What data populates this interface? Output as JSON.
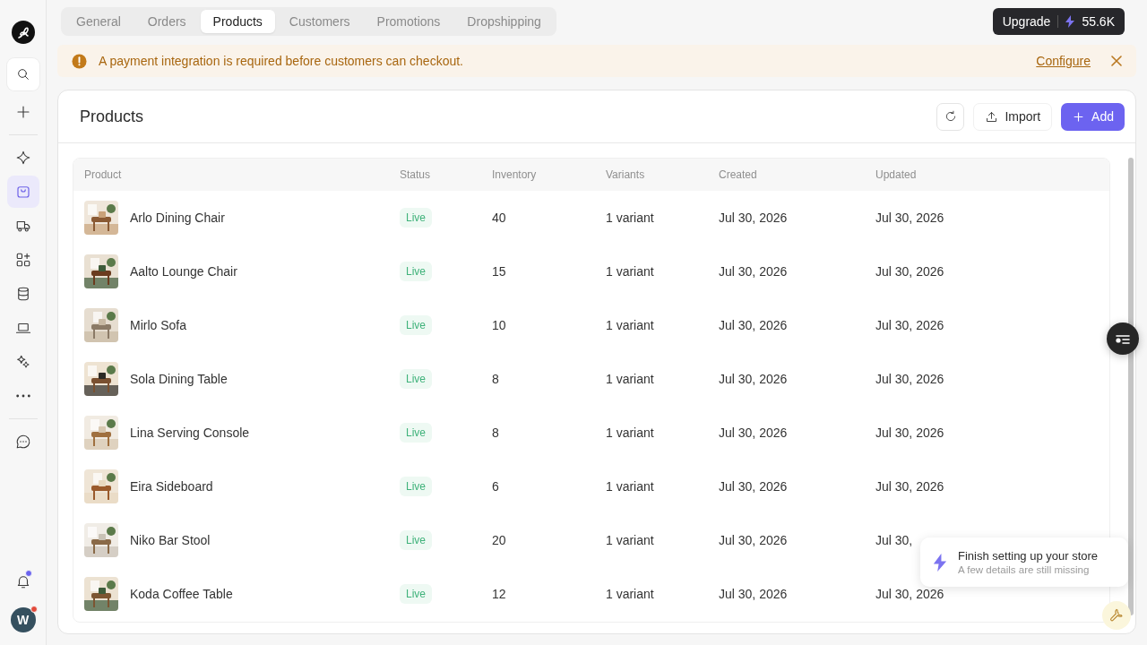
{
  "sidebar": {
    "avatar": "W",
    "items": [
      {
        "selected": false
      },
      {
        "selected": false
      },
      {
        "selected": false
      },
      {
        "selected": true
      },
      {
        "selected": false
      },
      {
        "selected": false
      },
      {
        "selected": false
      },
      {
        "selected": false
      },
      {
        "selected": false
      },
      {
        "selected": false
      },
      {
        "selected": false
      }
    ]
  },
  "tabs": [
    {
      "label": "General",
      "selected": false
    },
    {
      "label": "Orders",
      "selected": false
    },
    {
      "label": "Products",
      "selected": true
    },
    {
      "label": "Customers",
      "selected": false
    },
    {
      "label": "Promotions",
      "selected": false
    },
    {
      "label": "Dropshipping",
      "selected": false
    }
  ],
  "upgrade": {
    "label": "Upgrade",
    "credits": "55.6K"
  },
  "banner": {
    "message": "A payment integration is required before customers can checkout.",
    "link": "Configure"
  },
  "panel": {
    "title": "Products",
    "buttons": [
      {
        "label": "Import",
        "kind": "plain"
      },
      {
        "label": "Add",
        "kind": "primary"
      }
    ]
  },
  "table": {
    "columns": [
      "Product",
      "Status",
      "Inventory",
      "Variants",
      "Created",
      "Updated"
    ],
    "rows": [
      {
        "name": "Arlo Dining Chair",
        "status": "Live",
        "inventory": "40",
        "variants": "1 variant",
        "created": "Jul 30, 2026",
        "updated": "Jul 30, 2026"
      },
      {
        "name": "Aalto Lounge Chair",
        "status": "Live",
        "inventory": "15",
        "variants": "1 variant",
        "created": "Jul 30, 2026",
        "updated": "Jul 30, 2026"
      },
      {
        "name": "Mirlo Sofa",
        "status": "Live",
        "inventory": "10",
        "variants": "1 variant",
        "created": "Jul 30, 2026",
        "updated": "Jul 30, 2026"
      },
      {
        "name": "Sola Dining Table",
        "status": "Live",
        "inventory": "8",
        "variants": "1 variant",
        "created": "Jul 30, 2026",
        "updated": "Jul 30, 2026"
      },
      {
        "name": "Lina Serving Console",
        "status": "Live",
        "inventory": "8",
        "variants": "1 variant",
        "created": "Jul 30, 2026",
        "updated": "Jul 30, 2026"
      },
      {
        "name": "Eira Sideboard",
        "status": "Live",
        "inventory": "6",
        "variants": "1 variant",
        "created": "Jul 30, 2026",
        "updated": "Jul 30, 2026"
      },
      {
        "name": "Niko Bar Stool",
        "status": "Live",
        "inventory": "20",
        "variants": "1 variant",
        "created": "Jul 30, 2026",
        "updated": "Jul 30,"
      },
      {
        "name": "Koda Coffee Table",
        "status": "Live",
        "inventory": "12",
        "variants": "1 variant",
        "created": "Jul 30, 2026",
        "updated": "Jul 30, 2026"
      }
    ]
  },
  "toast": {
    "title": "Finish setting up your store",
    "subtitle": "A few details are still missing"
  }
}
